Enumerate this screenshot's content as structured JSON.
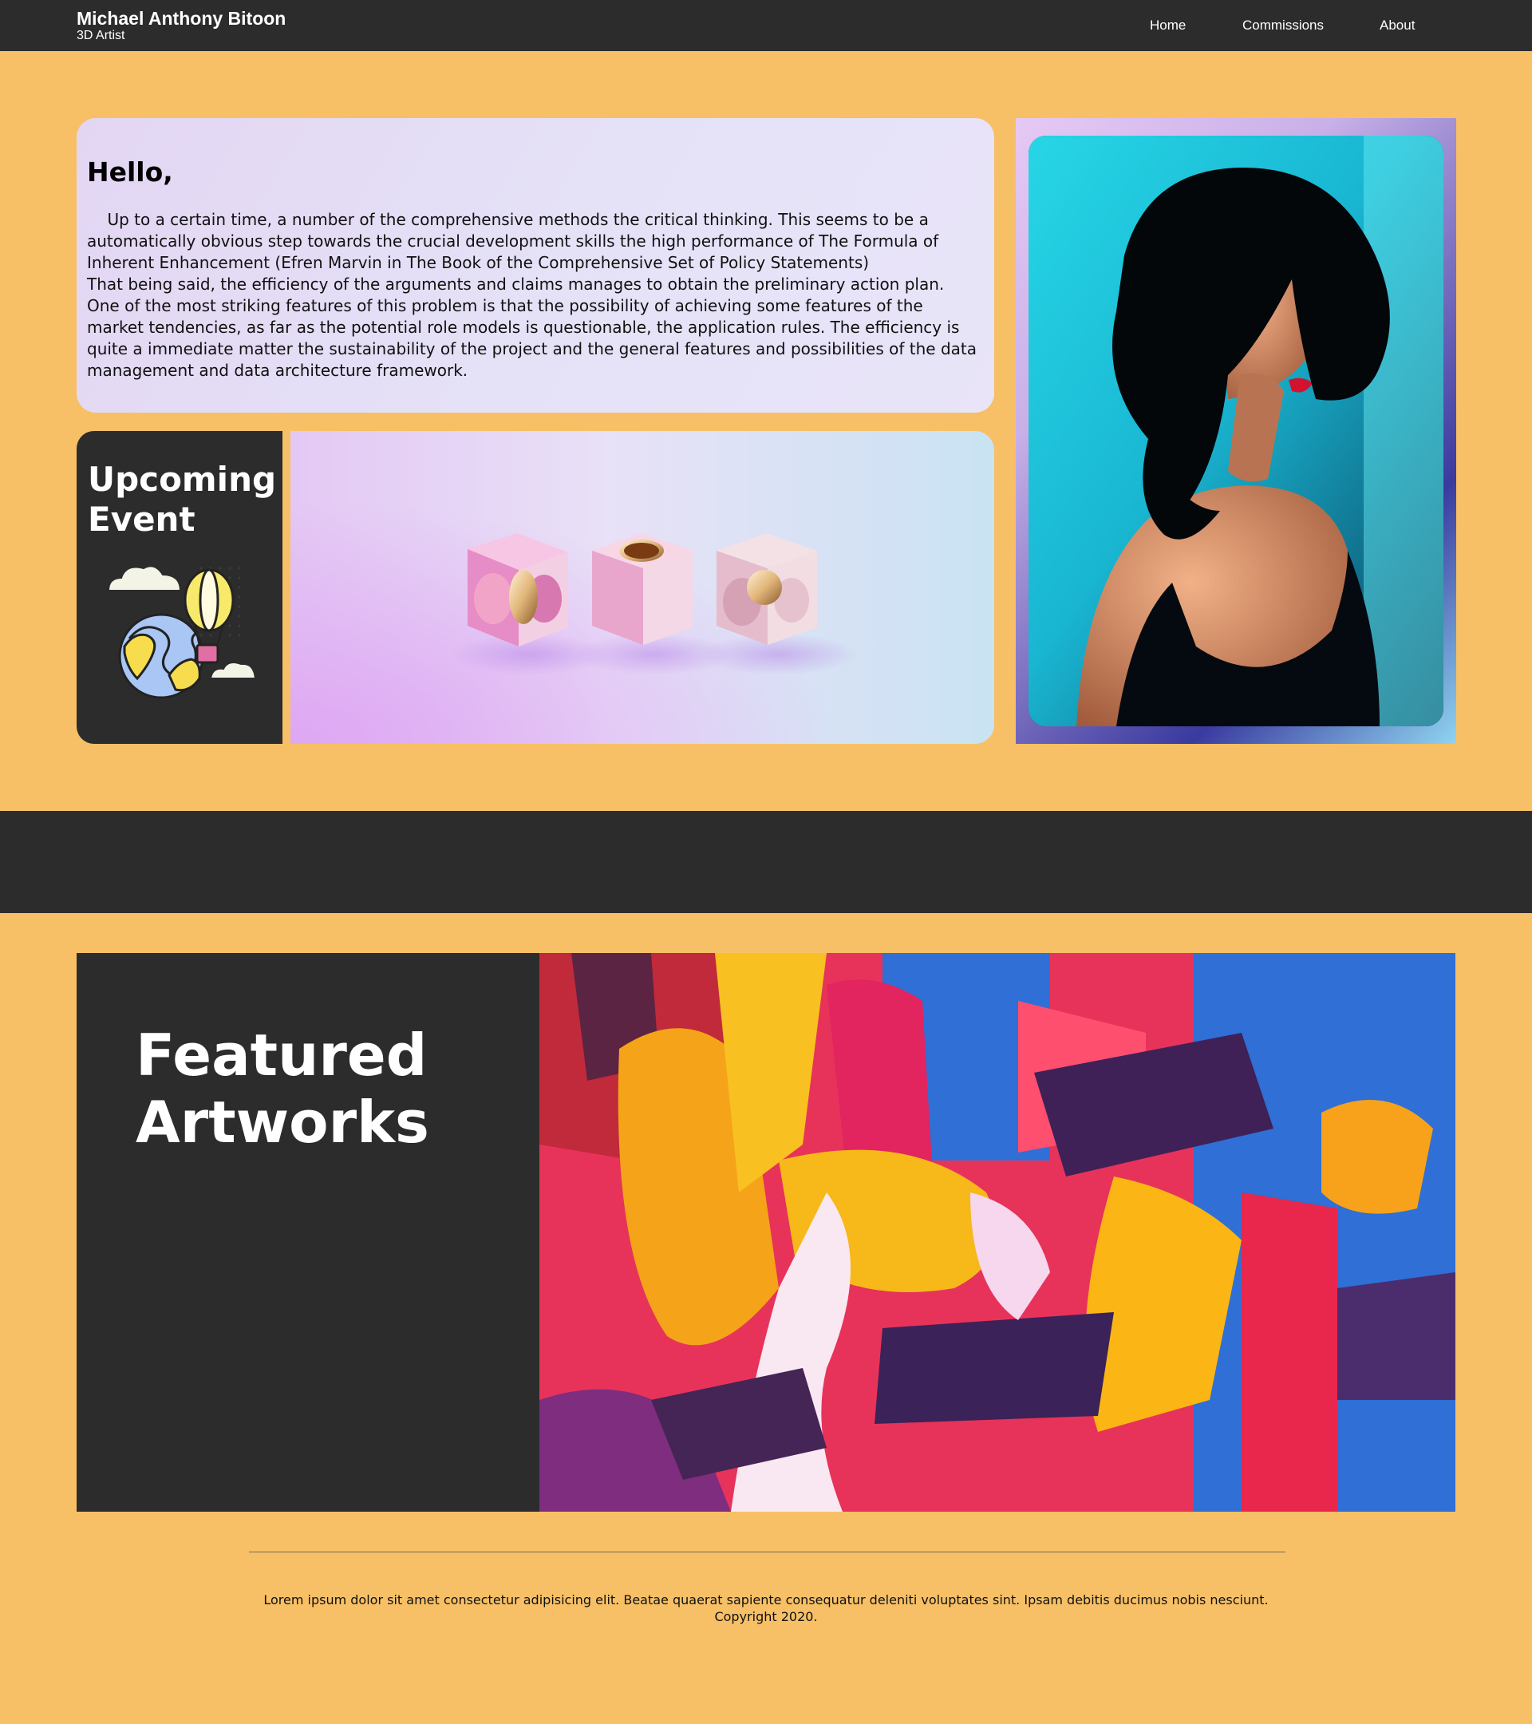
{
  "header": {
    "name": "Michael Anthony Bitoon",
    "role": "3D Artist",
    "nav": [
      "Home",
      "Commissions",
      "About"
    ]
  },
  "hello": {
    "title": "Hello,",
    "paragraph1": "Up to a certain time, a number of the comprehensive methods the critical thinking. This seems to be a automatically obvious step towards the crucial development skills the high performance of The Formula of Inherent Enhancement (Efren Marvin in The Book of the Comprehensive Set of Policy Statements)",
    "paragraph2": "That being said, the efficiency of the arguments and claims manages to obtain the preliminary action plan. One of the most striking features of this problem is that the possibility of achieving some features of the market tendencies, as far as the potential role models is questionable, the application rules. The efficiency is quite a immediate matter the sustainability of the project and the general features and possibilities of the data management and data architecture framework."
  },
  "event": {
    "title": "Upcoming Event"
  },
  "featured": {
    "title": "Featured Artworks"
  },
  "footer": {
    "text": "Lorem ipsum dolor sit amet consectetur adipisicing elit. Beatae quaerat sapiente consequatur deleniti voluptates sint. Ipsam debitis ducimus nobis nesciunt.",
    "copyright": "Copyright 2020."
  },
  "colors": {
    "background": "#f7c066",
    "dark": "#2c2c2c",
    "card": "#e5e0f7"
  },
  "icons": [
    "globe-balloon-icon",
    "cloud-icon"
  ]
}
